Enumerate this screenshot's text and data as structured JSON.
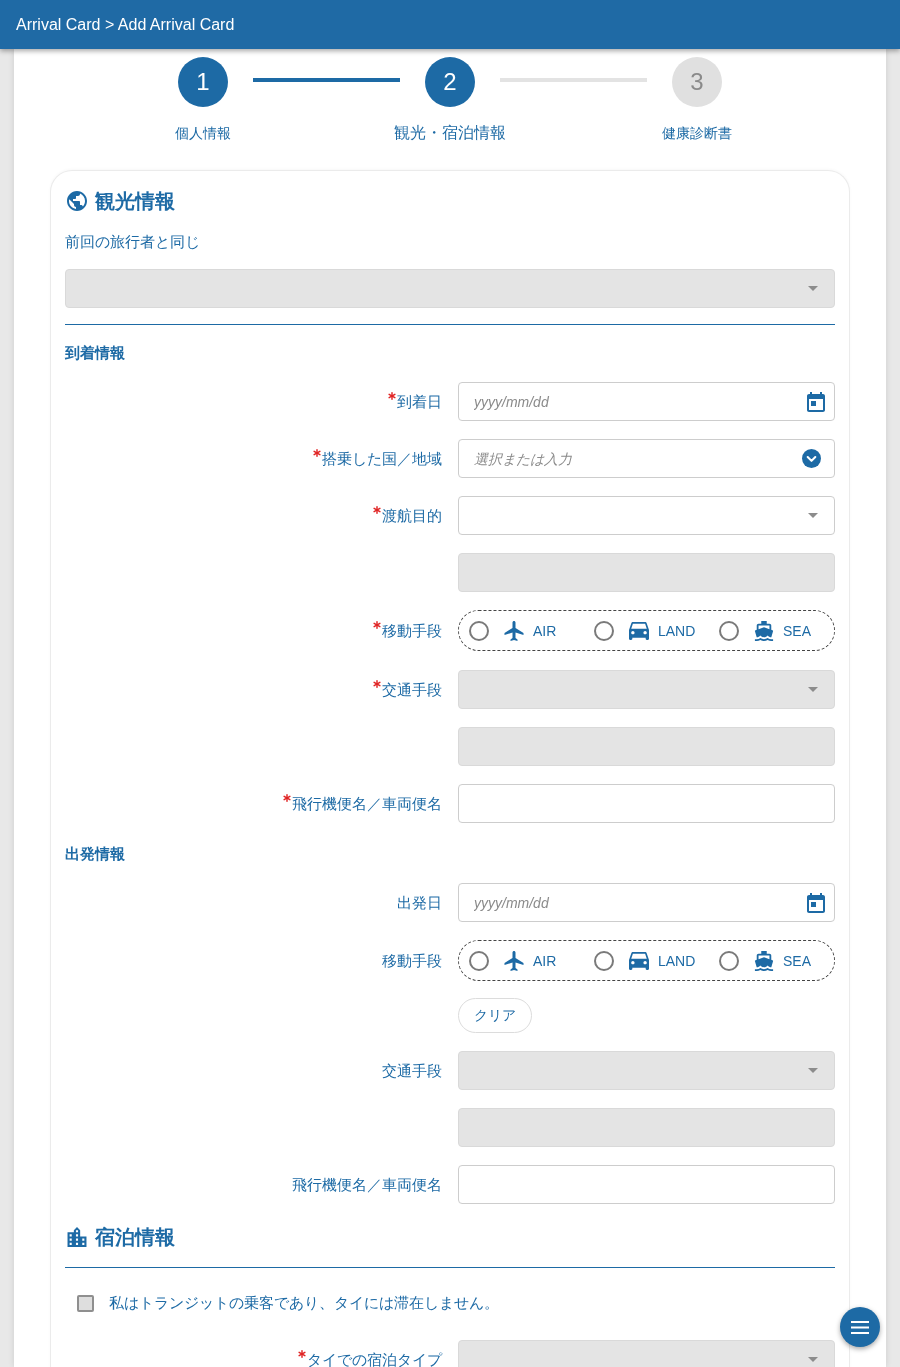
{
  "header": {
    "breadcrumb": "Arrival Card > Add Arrival Card"
  },
  "stepper": {
    "steps": [
      {
        "number": "1",
        "label": "個人情報",
        "selected": false
      },
      {
        "number": "2",
        "label": "観光・宿泊情報",
        "selected": true
      },
      {
        "number": "3",
        "label": "健康診断書",
        "selected": false
      }
    ]
  },
  "tourism_section": {
    "title": "観光情報",
    "same_as_previous": {
      "label": "前回の旅行者と同じ",
      "disabled": true
    },
    "groups": [
      {
        "title": "到着情報",
        "rows": [
          {
            "kind": "date",
            "label": "到着日",
            "required": true,
            "placeholder": "yyyy/mm/dd",
            "disabled": false
          },
          {
            "kind": "combo",
            "label": "搭乗した国／地域",
            "required": true,
            "placeholder": "選択または入力",
            "disabled": false
          },
          {
            "kind": "select",
            "label": "渡航目的",
            "required": true,
            "disabled": false
          },
          {
            "kind": "text",
            "disabled": true
          },
          {
            "kind": "radio",
            "label": "移動手段",
            "required": true,
            "options": [
              {
                "kind": "air",
                "label": "AIR",
                "selected": false
              },
              {
                "kind": "land",
                "label": "LAND",
                "selected": false
              },
              {
                "kind": "sea",
                "label": "SEA",
                "selected": false
              }
            ]
          },
          {
            "kind": "select",
            "label": "交通手段",
            "required": true,
            "disabled": true
          },
          {
            "kind": "text",
            "disabled": true
          },
          {
            "kind": "text",
            "label": "飛行機便名／車両便名",
            "required": true,
            "disabled": false
          }
        ]
      },
      {
        "title": "出発情報",
        "rows": [
          {
            "kind": "date",
            "label": "出発日",
            "required": false,
            "placeholder": "yyyy/mm/dd",
            "disabled": false
          },
          {
            "kind": "radio",
            "label": "移動手段",
            "required": false,
            "options": [
              {
                "kind": "air",
                "label": "AIR",
                "selected": false
              },
              {
                "kind": "land",
                "label": "LAND",
                "selected": false
              },
              {
                "kind": "sea",
                "label": "SEA",
                "selected": false
              }
            ]
          },
          {
            "kind": "button",
            "text": "クリア"
          },
          {
            "kind": "select",
            "label": "交通手段",
            "required": false,
            "disabled": true
          },
          {
            "kind": "text",
            "disabled": true
          },
          {
            "kind": "text",
            "label": "飛行機便名／車両便名",
            "required": false,
            "disabled": false
          }
        ]
      }
    ]
  },
  "lodging_section": {
    "title": "宿泊情報",
    "transit_checkbox": {
      "label": "私はトランジットの乗客であり、タイには滞在しません。",
      "checked": false
    },
    "rows": [
      {
        "kind": "select",
        "label": "タイでの宿泊タイプ",
        "required": true,
        "disabled": true
      }
    ]
  }
}
